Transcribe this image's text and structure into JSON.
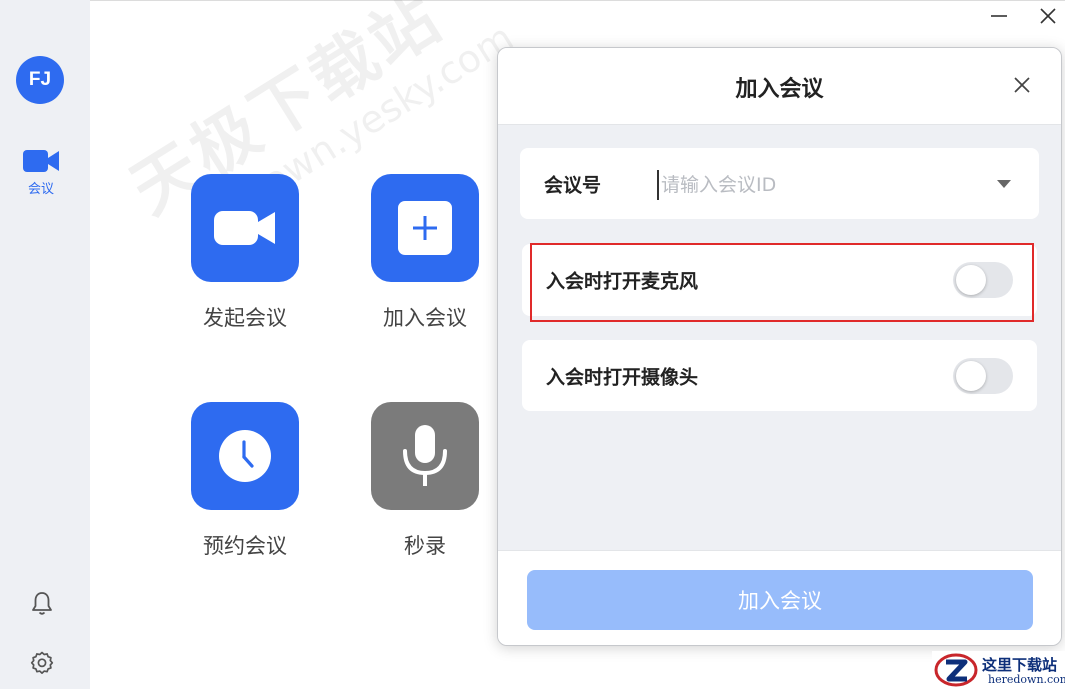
{
  "sidebar": {
    "avatar_initials": "FJ",
    "nav_meeting_label": "会议",
    "accent_color": "#2e6bf0"
  },
  "watermark": {
    "line1": "天极下载站",
    "line2": "mydown.yesky.com"
  },
  "actions": [
    {
      "label": "发起会议",
      "icon": "video-camera-icon"
    },
    {
      "label": "加入会议",
      "icon": "plus-icon"
    },
    {
      "label": "预约会议",
      "icon": "clock-icon"
    },
    {
      "label": "秒录",
      "icon": "microphone-icon"
    }
  ],
  "dialog": {
    "title": "加入会议",
    "meeting_id_label": "会议号",
    "meeting_id_placeholder": "请输入会议ID",
    "meeting_id_value": "",
    "mic_toggle_label": "入会时打开麦克风",
    "mic_toggle_on": false,
    "camera_toggle_label": "入会时打开摄像头",
    "camera_toggle_on": false,
    "join_button_label": "加入会议",
    "highlight_color": "#e02a2a"
  },
  "corner_logo": {
    "text_cn": "这里下载站",
    "text_en": "heredown.com"
  }
}
